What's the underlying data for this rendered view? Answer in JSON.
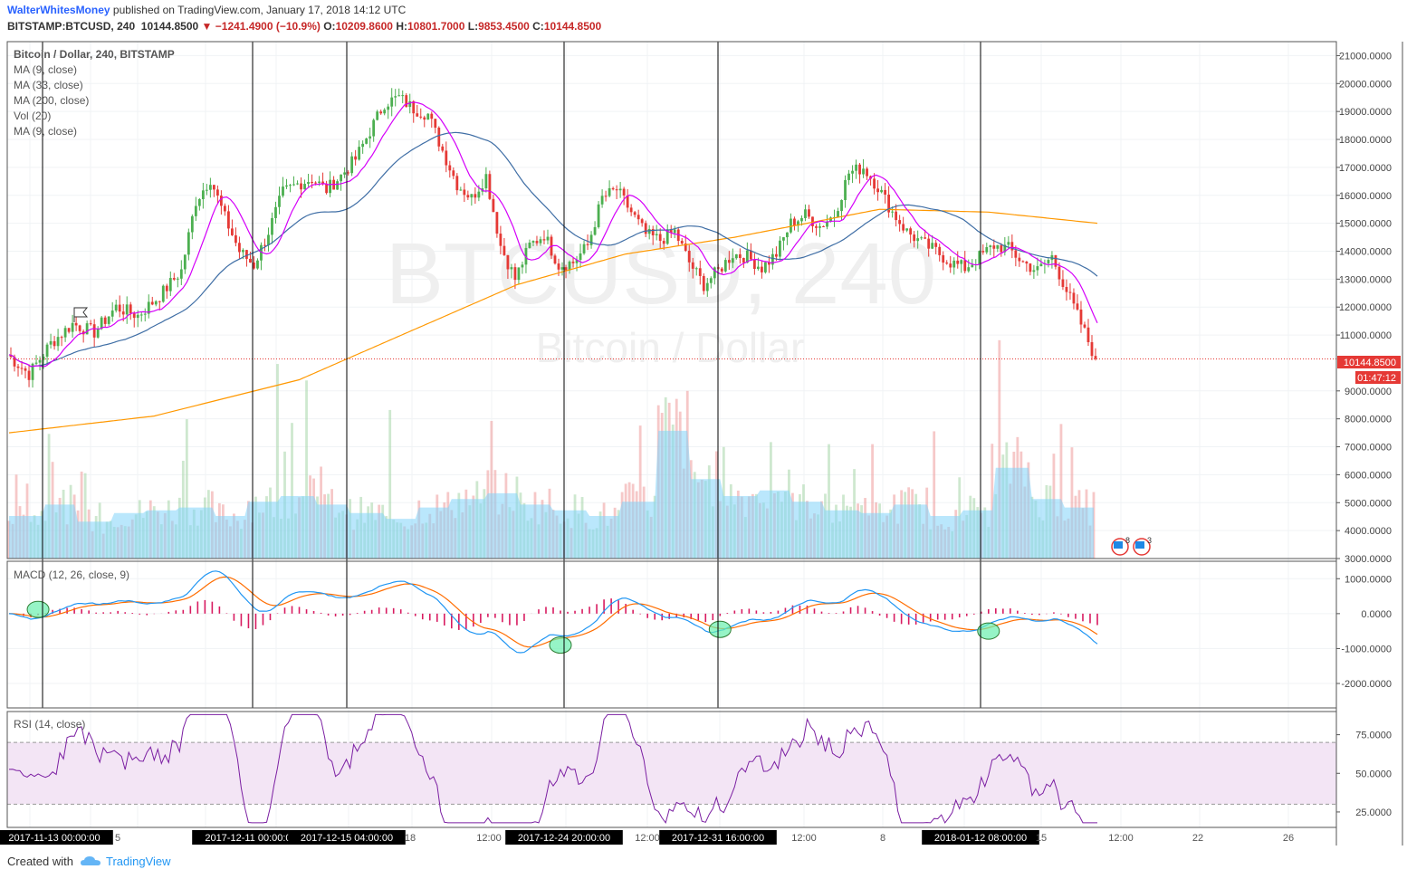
{
  "header": {
    "author": "WalterWhitesMoney",
    "published_text": "published on TradingView.com, January 17, 2018 14:12 UTC",
    "symbol": "BITSTAMP:BTCUSD, 240",
    "last": "10144.8500",
    "change": "−1241.4900 (−10.9%)",
    "open_label": "O:",
    "open": "10209.8600",
    "high_label": "H:",
    "high": "10801.7000",
    "low_label": "L:",
    "low": "9853.4500",
    "close_label": "C:",
    "close": "10144.8500"
  },
  "legend": {
    "title": "Bitcoin / Dollar, 240, BITSTAMP",
    "ma1": "MA (9, close)",
    "ma2": "MA (33, close)",
    "ma3": "MA (200, close)",
    "vol": "Vol (20)",
    "ma4": "MA (9, close)",
    "macd": "MACD (12, 26, close, 9)",
    "rsi": "RSI (14, close)"
  },
  "watermark": {
    "symbol": "BTCUSD, 240",
    "name": "Bitcoin / Dollar"
  },
  "price_badge": "10144.8500",
  "countdown_badge": "01:47:12",
  "event_badges": {
    "a": "8",
    "b": "3"
  },
  "colors": {
    "up": "#4caf50",
    "down": "#e53935",
    "ma9": "#d500f9",
    "ma33": "#3f6ea5",
    "ma200": "#ff9800",
    "macd": "#2196f3",
    "signal": "#ff6d00",
    "hist": "#d81b60",
    "rsi": "#7b1fa2",
    "rsi_band": "#f3e5f5",
    "vol_ma": "#81d4fa"
  },
  "footer": {
    "created_with": "Created with",
    "brand": "TradingView"
  },
  "chart_data": {
    "type": "candlestick",
    "price_axis_ticks": [
      "21000.0000",
      "20000.0000",
      "19000.0000",
      "18000.0000",
      "17000.0000",
      "16000.0000",
      "15000.0000",
      "14000.0000",
      "13000.0000",
      "12000.0000",
      "11000.0000",
      "9000.0000",
      "8000.0000",
      "7000.0000",
      "6000.0000",
      "5000.0000",
      "4000.0000",
      "3000.0000"
    ],
    "price_range": [
      3000,
      21500
    ],
    "macd_axis_ticks": [
      "1000.0000",
      "0.0000",
      "-1000.0000",
      "-2000.0000"
    ],
    "macd_range": [
      -2700,
      1500
    ],
    "rsi_axis_ticks": [
      "75.0000",
      "50.0000",
      "25.0000"
    ],
    "rsi_range": [
      15,
      90
    ],
    "rsi_band": [
      30,
      70
    ],
    "time_labels": [
      "2017-11-13 00:00:00",
      "5",
      "2017-12-11 00:00:00",
      "2017-12-15 04:00:00",
      "18",
      "12:00",
      "2017-12-24 20:00:00",
      "12:00",
      "2017-12-31 16:00:00",
      "12:00",
      "8",
      "2018-01-12 08:00:00",
      "15",
      "12:00",
      "22",
      "26"
    ],
    "highlighted_times": [
      "2017-11-13 00:00:00",
      "2017-12-11 00:00:00",
      "2017-12-15 04:00:00",
      "2017-12-24 20:00:00",
      "2017-12-31 16:00:00",
      "2018-01-12 08:00:00"
    ],
    "close_path": [
      [
        0,
        10300
      ],
      [
        6,
        9600
      ],
      [
        12,
        10700
      ],
      [
        18,
        11400
      ],
      [
        24,
        11100
      ],
      [
        30,
        12000
      ],
      [
        36,
        11700
      ],
      [
        42,
        12400
      ],
      [
        48,
        13300
      ],
      [
        52,
        15800
      ],
      [
        56,
        16600
      ],
      [
        60,
        15200
      ],
      [
        64,
        14000
      ],
      [
        68,
        13500
      ],
      [
        72,
        14700
      ],
      [
        76,
        16100
      ],
      [
        80,
        16400
      ],
      [
        84,
        16600
      ],
      [
        88,
        16200
      ],
      [
        92,
        16700
      ],
      [
        96,
        17300
      ],
      [
        100,
        18300
      ],
      [
        104,
        19300
      ],
      [
        108,
        19500
      ],
      [
        112,
        19100
      ],
      [
        116,
        18900
      ],
      [
        120,
        17600
      ],
      [
        124,
        16400
      ],
      [
        128,
        15900
      ],
      [
        132,
        16700
      ],
      [
        136,
        14200
      ],
      [
        140,
        13000
      ],
      [
        144,
        14200
      ],
      [
        148,
        14600
      ],
      [
        152,
        13500
      ],
      [
        156,
        13600
      ],
      [
        160,
        14200
      ],
      [
        164,
        15900
      ],
      [
        168,
        16200
      ],
      [
        172,
        15400
      ],
      [
        176,
        14600
      ],
      [
        180,
        14400
      ],
      [
        184,
        14700
      ],
      [
        188,
        13600
      ],
      [
        192,
        12800
      ],
      [
        196,
        13300
      ],
      [
        200,
        13900
      ],
      [
        204,
        13800
      ],
      [
        208,
        13400
      ],
      [
        212,
        13900
      ],
      [
        216,
        15000
      ],
      [
        220,
        15300
      ],
      [
        224,
        14900
      ],
      [
        228,
        15300
      ],
      [
        232,
        16800
      ],
      [
        236,
        17000
      ],
      [
        240,
        16300
      ],
      [
        244,
        15400
      ],
      [
        248,
        14700
      ],
      [
        252,
        14300
      ],
      [
        256,
        14000
      ],
      [
        260,
        13600
      ],
      [
        264,
        13400
      ],
      [
        268,
        13800
      ],
      [
        272,
        14200
      ],
      [
        276,
        14100
      ],
      [
        280,
        13600
      ],
      [
        284,
        13300
      ],
      [
        288,
        13800
      ],
      [
        292,
        12600
      ],
      [
        296,
        11400
      ],
      [
        300,
        10145
      ]
    ],
    "ma200_path": [
      [
        0,
        7500
      ],
      [
        40,
        8100
      ],
      [
        80,
        9400
      ],
      [
        110,
        11100
      ],
      [
        140,
        12800
      ],
      [
        170,
        13900
      ],
      [
        200,
        14500
      ],
      [
        240,
        15500
      ],
      [
        270,
        15400
      ],
      [
        300,
        15000
      ]
    ],
    "volume_levels": [
      1.5,
      1.9,
      1.3,
      1.6,
      1.7,
      1.8,
      1.5,
      2.0,
      2.2,
      1.9,
      1.6,
      1.4,
      1.8,
      2.1,
      2.3,
      1.9,
      1.7,
      1.5,
      2.0,
      4.5,
      2.8,
      2.2,
      2.4,
      2.0,
      1.7,
      1.6,
      1.9,
      1.5,
      1.7,
      3.2,
      2.1,
      1.8
    ],
    "macd_cross_markers": [
      [
        8,
        120
      ],
      [
        152,
        -900
      ],
      [
        196,
        -450
      ],
      [
        270,
        -500
      ]
    ]
  }
}
